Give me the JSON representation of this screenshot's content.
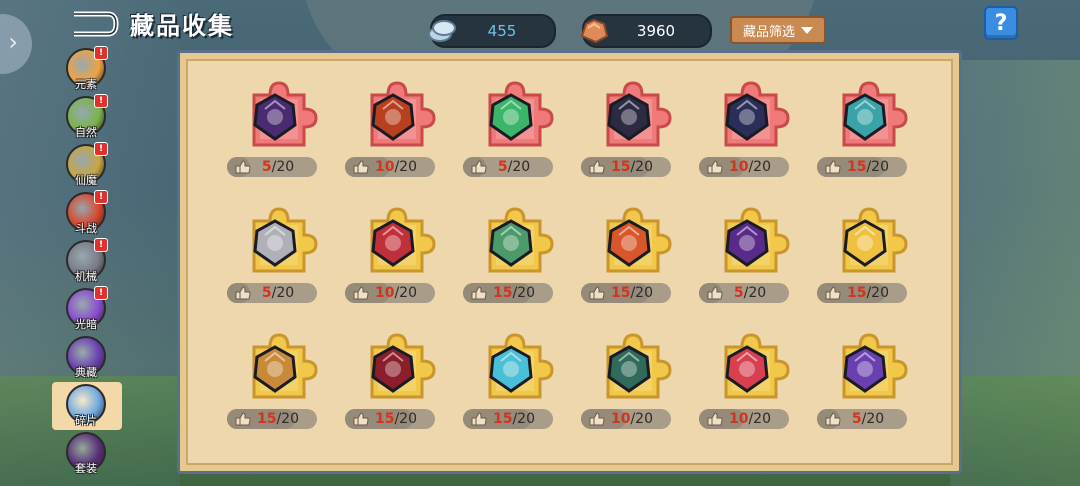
{
  "header": {
    "title": "藏品收集",
    "filter_label": "藏品筛选",
    "help_label": "?"
  },
  "currencies": [
    {
      "name": "silver-coins-icon",
      "value": "455",
      "color": "#6fc1e8"
    },
    {
      "name": "copper-ore-icon",
      "value": "3960",
      "color": "#ffffff"
    }
  ],
  "sidebar": {
    "items": [
      {
        "label": "元素",
        "badge": "!",
        "color": "#f0a341"
      },
      {
        "label": "自然",
        "badge": "!",
        "color": "#7bb34a"
      },
      {
        "label": "仙魔",
        "badge": "!",
        "color": "#c9a642"
      },
      {
        "label": "斗战",
        "badge": "!",
        "color": "#d9452c"
      },
      {
        "label": "机械",
        "badge": "!",
        "color": "#7a7a86"
      },
      {
        "label": "光暗",
        "badge": "!",
        "color": "#8a4ad0"
      },
      {
        "label": "典藏",
        "badge": "",
        "color": "#6a3fb0"
      },
      {
        "label": "碎片",
        "badge": "",
        "color": "#6ea9e0",
        "active": true
      },
      {
        "label": "套装",
        "badge": "",
        "color": "#5a2f7a"
      }
    ]
  },
  "collection": {
    "items": [
      {
        "name": "dark-tome-icon",
        "current": "5",
        "total": "/20",
        "frame": "#f07a7a",
        "art": "#4a2a70"
      },
      {
        "name": "fire-amulet-icon",
        "current": "10",
        "total": "/20",
        "frame": "#f07a7a",
        "art": "#b8401e"
      },
      {
        "name": "jade-sword-icon",
        "current": "5",
        "total": "/20",
        "frame": "#f07a7a",
        "art": "#3bb56a"
      },
      {
        "name": "gold-chest-icon",
        "current": "15",
        "total": "/20",
        "frame": "#f07a7a",
        "art": "#2d2a44"
      },
      {
        "name": "mech-drill-icon",
        "current": "10",
        "total": "/20",
        "frame": "#f07a7a",
        "art": "#2a2e58"
      },
      {
        "name": "compass-shield-icon",
        "current": "15",
        "total": "/20",
        "frame": "#f07a7a",
        "art": "#3aa3a8"
      },
      {
        "name": "silver-armor-icon",
        "current": "5",
        "total": "/20",
        "frame": "#f2c84a",
        "art": "#b0b0b8"
      },
      {
        "name": "beast-skull-icon",
        "current": "10",
        "total": "/20",
        "frame": "#f2c84a",
        "art": "#c0303a"
      },
      {
        "name": "dragon-helm-icon",
        "current": "15",
        "total": "/20",
        "frame": "#f2c84a",
        "art": "#4a9a6a"
      },
      {
        "name": "flame-gate-icon",
        "current": "15",
        "total": "/20",
        "frame": "#f2c84a",
        "art": "#d7562a"
      },
      {
        "name": "void-cannon-icon",
        "current": "5",
        "total": "/20",
        "frame": "#f2c84a",
        "art": "#5a2a8a"
      },
      {
        "name": "sun-crest-icon",
        "current": "15",
        "total": "/20",
        "frame": "#f2c84a",
        "art": "#f0c040"
      },
      {
        "name": "treasure-box-icon",
        "current": "15",
        "total": "/20",
        "frame": "#f2c84a",
        "art": "#c88a38"
      },
      {
        "name": "crimson-orb-icon",
        "current": "15",
        "total": "/20",
        "frame": "#f2c84a",
        "art": "#8a1e2a"
      },
      {
        "name": "ice-crystal-icon",
        "current": "15",
        "total": "/20",
        "frame": "#f2c84a",
        "art": "#4ac0d8"
      },
      {
        "name": "green-shield-icon",
        "current": "10",
        "total": "/20",
        "frame": "#f2c84a",
        "art": "#2f6a5a"
      },
      {
        "name": "rocket-drill-icon",
        "current": "10",
        "total": "/20",
        "frame": "#f2c84a",
        "art": "#d84050"
      },
      {
        "name": "crossed-blades-icon",
        "current": "5",
        "total": "/20",
        "frame": "#f2c84a",
        "art": "#6a3fb0"
      }
    ]
  }
}
